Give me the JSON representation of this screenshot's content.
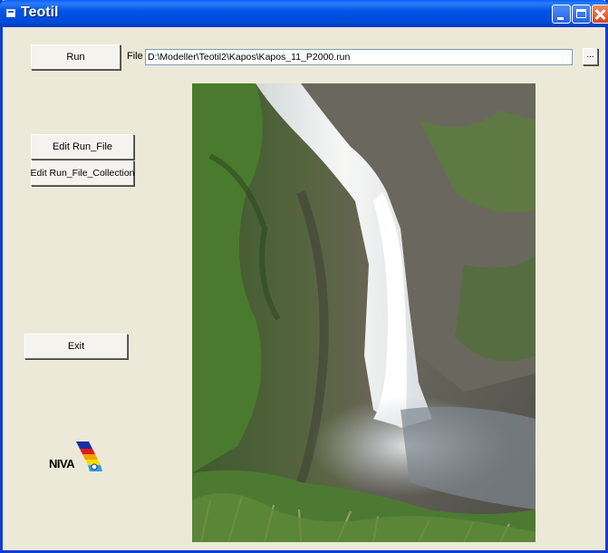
{
  "window": {
    "title": "Teotil",
    "title_icon": "app-icon",
    "controls": [
      "minimize-icon",
      "maximize-icon",
      "close-icon"
    ]
  },
  "toolbar": {
    "run_label": "Run",
    "file_label": "File",
    "file_value": "D:\\Modeller\\Teotil2\\Kapos\\Kapos_11_P2000.run",
    "browse_label": "..."
  },
  "sidebar": {
    "edit_run_file_label": "Edit Run_File",
    "edit_run_file_collection_label": "Edit Run_File_Collection",
    "exit_label": "Exit"
  },
  "logo": {
    "text": "NIVA",
    "colors": [
      "#1b2ea6",
      "#e01b1b",
      "#f5a000",
      "#f0e000",
      "#2aa0e0"
    ]
  },
  "image": {
    "content": "waterfall-photo",
    "colors": {
      "rock": "#5c5a50",
      "moss": "#4f7a35",
      "water": "#f2f4f6",
      "mist": "#c9d0d6"
    }
  }
}
